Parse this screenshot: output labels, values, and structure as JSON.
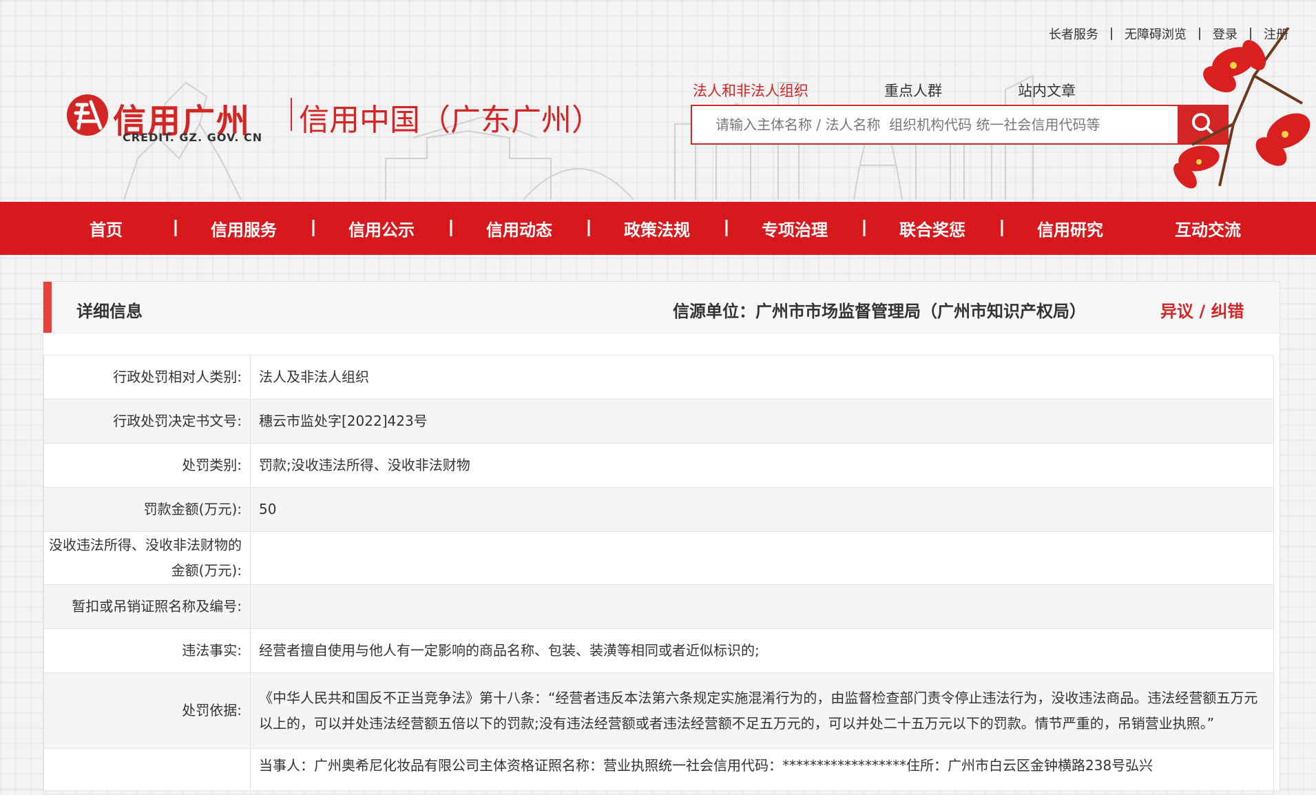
{
  "top_links": [
    "长者服务",
    "无障碍浏览",
    "登录",
    "注册"
  ],
  "logo": {
    "title": "信用广州",
    "domain": "CREDIT. GZ. GOV. CN",
    "slogan": "信用中国（广东广州）"
  },
  "search": {
    "tabs": [
      "法人和非法人组织",
      "重点人群",
      "站内文章"
    ],
    "active_tab": "法人和非法人组织",
    "placeholder": "请输入主体名称 / 法人名称  组织机构代码 统一社会信用代码等"
  },
  "nav": [
    "首页",
    "信用服务",
    "信用公示",
    "信用动态",
    "政策法规",
    "专项治理",
    "联合奖惩",
    "信用研究",
    "互动交流"
  ],
  "panel": {
    "title": "详细信息",
    "source": "信源单位：广州市市场监督管理局（广州市知识产权局）",
    "dispute": "异议 / 纠错"
  },
  "details": [
    {
      "label": "行政处罚相对人类别:",
      "value": "法人及非法人组织"
    },
    {
      "label": "行政处罚决定书文号:",
      "value": "穗云市监处字[2022]423号"
    },
    {
      "label": "处罚类别:",
      "value": "罚款;没收违法所得、没收非法财物"
    },
    {
      "label": "罚款金额(万元):",
      "value": "50"
    },
    {
      "label": "没收违法所得、没收非法财物的金额(万元):",
      "value": ""
    },
    {
      "label": "暂扣或吊销证照名称及编号:",
      "value": ""
    },
    {
      "label": "违法事实:",
      "value": "经营者擅自使用与他人有一定影响的商品名称、包装、装潢等相同或者近似标识的;"
    },
    {
      "label": "处罚依据:",
      "value": "《中华人民共和国反不正当竞争法》第十八条：“经营者违反本法第六条规定实施混淆行为的，由监督检查部门责令停止违法行为，没收违法商品。违法经营额五万元以上的，可以并处违法经营额五倍以下的罚款;没有违法经营额或者违法经营额不足五万元的，可以并处二十五万元以下的罚款。情节严重的，吊销营业执照。”"
    },
    {
      "label": "",
      "value": "当事人：广州奥希尼化妆品有限公司主体资格证照名称：营业执照统一社会信用代码：******************住所：广州市白云区金钟横路238号弘兴"
    }
  ],
  "colors": {
    "brand_red": "#d7191d",
    "accent": "#e8413c"
  }
}
